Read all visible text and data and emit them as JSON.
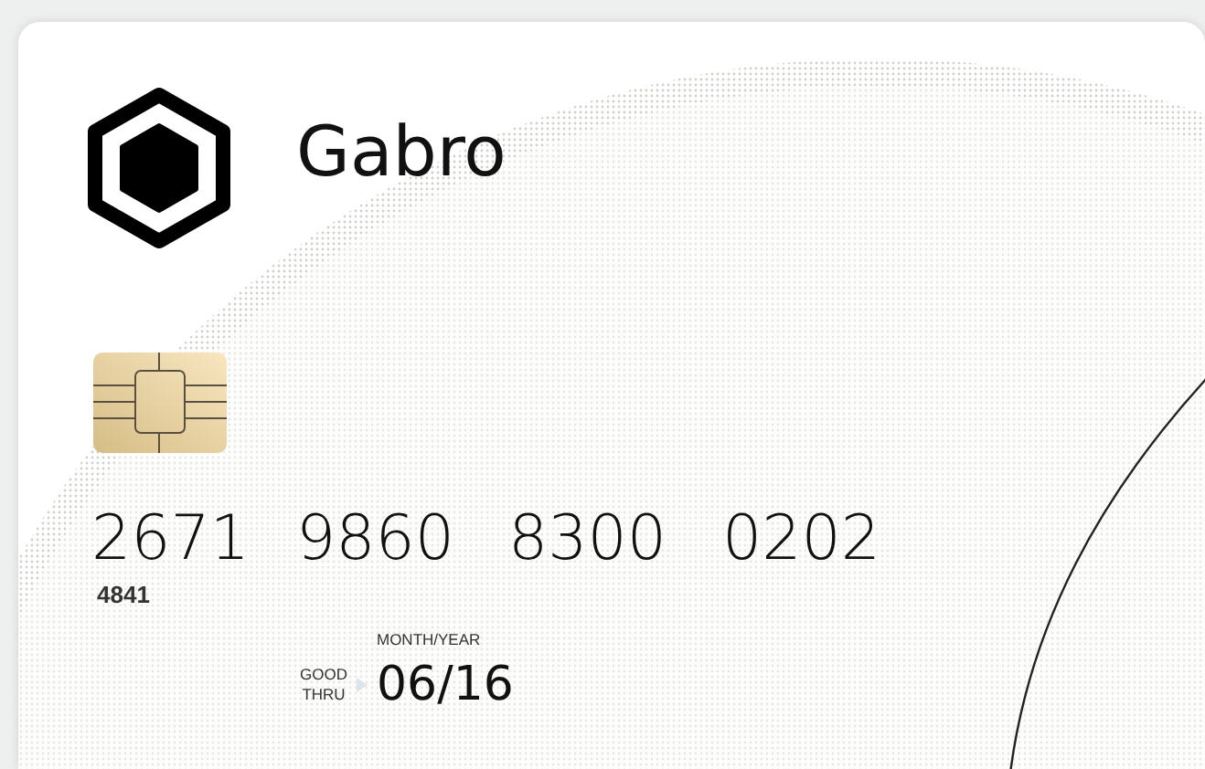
{
  "brand": {
    "name": "Gabro"
  },
  "card_number": [
    "2671",
    "9860",
    "8300",
    "0202"
  ],
  "number_prefix": "4841",
  "expiry": {
    "label_top": "MONTH/YEAR",
    "label_left": [
      "GOOD",
      "THRU"
    ],
    "value": "06/16"
  }
}
